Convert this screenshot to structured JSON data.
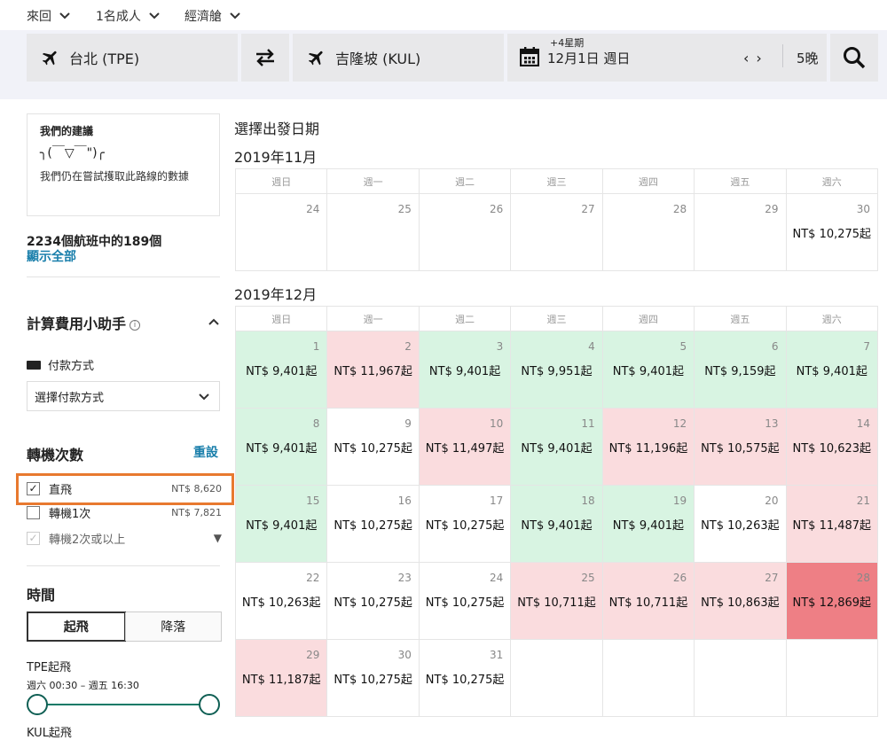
{
  "top_options": {
    "trip_type": "來回",
    "passengers": "1名成人",
    "cabin": "經濟艙"
  },
  "search": {
    "origin": "台北 (TPE)",
    "destination": "吉隆坡 (KUL)",
    "date_note": "+4星期",
    "date": "12月1日 週日",
    "nights": "5晚",
    "origin_icon": "plane-icon",
    "swap_icon": "swap-arrows-icon",
    "calendar_icon": "calendar-icon",
    "search_icon": "search-icon"
  },
  "sidebar": {
    "recommend_title": "我們的建議",
    "recommend_face": "╮(￣▽￣\")╭",
    "recommend_text": "我們仍在嘗試擭取此路線的數據",
    "count_text": "2234個航班中的189個",
    "show_all": "顯示全部",
    "fee_title": "計算費用小助手",
    "pay_label": "付款方式",
    "pay_select": "選擇付款方式",
    "stops_title": "轉機次數",
    "reset": "重設",
    "stops": [
      {
        "label": "直飛",
        "price": "NT$ 8,620",
        "checked": "✓"
      },
      {
        "label": "轉機1次",
        "price": "NT$ 7,821",
        "checked": ""
      },
      {
        "label": "轉機2次或以上",
        "price": "",
        "checked": "✓"
      }
    ],
    "time_title": "時間",
    "tab_depart": "起飛",
    "tab_land": "降落",
    "tpe_label": "TPE起飛",
    "tpe_range": "週六 00:30 – 週五 16:30",
    "kul_label": "KUL起飛"
  },
  "calendar": {
    "heading": "選擇出發日期",
    "weekdays": [
      "週日",
      "週一",
      "週二",
      "週三",
      "週四",
      "週五",
      "週六"
    ],
    "months": [
      {
        "title": "2019年11月",
        "cells": [
          {
            "day": "24",
            "price": "",
            "color": "white"
          },
          {
            "day": "25",
            "price": "",
            "color": "white"
          },
          {
            "day": "26",
            "price": "",
            "color": "white"
          },
          {
            "day": "27",
            "price": "",
            "color": "white"
          },
          {
            "day": "28",
            "price": "",
            "color": "white"
          },
          {
            "day": "29",
            "price": "",
            "color": "white"
          },
          {
            "day": "30",
            "price": "NT$ 10,275起",
            "color": "white"
          }
        ]
      },
      {
        "title": "2019年12月",
        "cells": [
          {
            "day": "1",
            "price": "NT$ 9,401起",
            "color": "green"
          },
          {
            "day": "2",
            "price": "NT$ 11,967起",
            "color": "pink"
          },
          {
            "day": "3",
            "price": "NT$ 9,401起",
            "color": "green"
          },
          {
            "day": "4",
            "price": "NT$ 9,951起",
            "color": "green"
          },
          {
            "day": "5",
            "price": "NT$ 9,401起",
            "color": "green"
          },
          {
            "day": "6",
            "price": "NT$ 9,159起",
            "color": "green"
          },
          {
            "day": "7",
            "price": "NT$ 9,401起",
            "color": "green"
          },
          {
            "day": "8",
            "price": "NT$ 9,401起",
            "color": "green"
          },
          {
            "day": "9",
            "price": "NT$ 10,275起",
            "color": "white"
          },
          {
            "day": "10",
            "price": "NT$ 11,497起",
            "color": "pink"
          },
          {
            "day": "11",
            "price": "NT$ 9,401起",
            "color": "green"
          },
          {
            "day": "12",
            "price": "NT$ 11,196起",
            "color": "pink"
          },
          {
            "day": "13",
            "price": "NT$ 10,575起",
            "color": "pink"
          },
          {
            "day": "14",
            "price": "NT$ 10,623起",
            "color": "pink"
          },
          {
            "day": "15",
            "price": "NT$ 9,401起",
            "color": "green"
          },
          {
            "day": "16",
            "price": "NT$ 10,275起",
            "color": "white"
          },
          {
            "day": "17",
            "price": "NT$ 10,275起",
            "color": "white"
          },
          {
            "day": "18",
            "price": "NT$ 9,401起",
            "color": "green"
          },
          {
            "day": "19",
            "price": "NT$ 9,401起",
            "color": "green"
          },
          {
            "day": "20",
            "price": "NT$ 10,263起",
            "color": "white"
          },
          {
            "day": "21",
            "price": "NT$ 11,487起",
            "color": "pink"
          },
          {
            "day": "22",
            "price": "NT$ 10,263起",
            "color": "white"
          },
          {
            "day": "23",
            "price": "NT$ 10,275起",
            "color": "white"
          },
          {
            "day": "24",
            "price": "NT$ 10,275起",
            "color": "white"
          },
          {
            "day": "25",
            "price": "NT$ 10,711起",
            "color": "pink"
          },
          {
            "day": "26",
            "price": "NT$ 10,711起",
            "color": "pink"
          },
          {
            "day": "27",
            "price": "NT$ 10,863起",
            "color": "pink"
          },
          {
            "day": "28",
            "price": "NT$ 12,869起",
            "color": "red"
          },
          {
            "day": "29",
            "price": "NT$ 11,187起",
            "color": "pink"
          },
          {
            "day": "30",
            "price": "NT$ 10,275起",
            "color": "white"
          },
          {
            "day": "31",
            "price": "NT$ 10,275起",
            "color": "white"
          },
          {
            "day": "",
            "price": "",
            "color": "empty"
          },
          {
            "day": "",
            "price": "",
            "color": "empty"
          },
          {
            "day": "",
            "price": "",
            "color": "empty"
          },
          {
            "day": "",
            "price": "",
            "color": "empty"
          }
        ]
      }
    ]
  },
  "colors": {
    "accent_link": "#1a7fab",
    "highlight_border": "#e8792f",
    "cheap_day": "#d8f4e2",
    "pricey_day": "#fadcde",
    "most_expensive_day": "#ee7f85"
  }
}
